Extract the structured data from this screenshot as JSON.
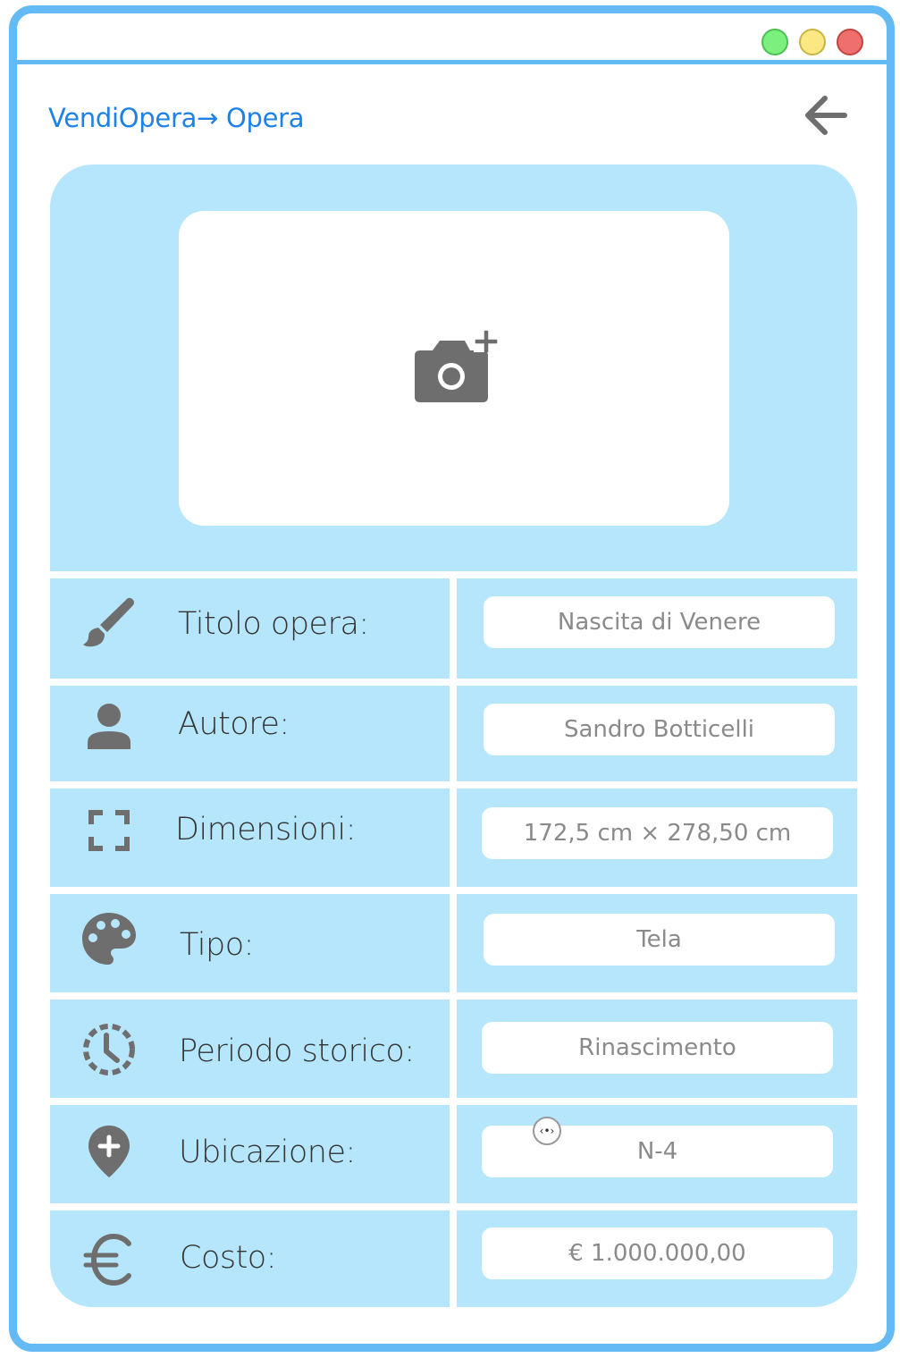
{
  "breadcrumb": {
    "text": "VendiOpera→ Opera"
  },
  "rows": [
    {
      "label": "Titolo opera:",
      "value": "Nascita di Venere",
      "icon": "paintbrush-icon"
    },
    {
      "label": "Autore:",
      "value": "Sandro Botticelli",
      "icon": "person-icon"
    },
    {
      "label": "Dimensioni:",
      "value": "172,5 cm × 278,50 cm",
      "icon": "fullscreen-icon"
    },
    {
      "label": "Tipo:",
      "value": "Tela",
      "icon": "palette-icon"
    },
    {
      "label": "Periodo storico:",
      "value": "Rinascimento",
      "icon": "clock-dashed-icon"
    },
    {
      "label": "Ubicazione:",
      "value": "N-4",
      "icon": "location-add-icon"
    },
    {
      "label": "Costo:",
      "value": "€ 1.000.000,00",
      "icon": "euro-icon"
    }
  ],
  "cursor_indicator": "‹•›",
  "colors": {
    "accent": "#63baf4",
    "card": "#b6e6fb",
    "link": "#1d82e6",
    "icon": "#6e6e6e"
  }
}
